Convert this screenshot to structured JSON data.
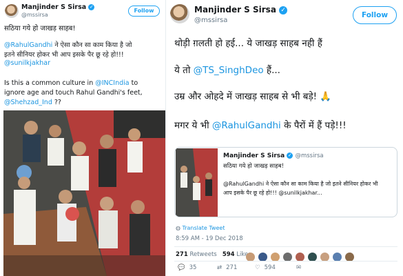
{
  "left": {
    "author": {
      "name": "Manjinder S Sirsa",
      "handle": "@mssirsa"
    },
    "follow_label": "Follow",
    "lines": {
      "l1": "सठिया गये हो जाखड़ साहब!",
      "l2_mention": "@RahulGandhi",
      "l2_rest": " ने ऐसा कौन सा काम किया है जो",
      "l3": "इतने सीनियर होकर भी आप इसके पैर छू रहे हो!!!",
      "l4_mention": "@sunilkjakhar",
      "l5_pre": "Is this a common culture in ",
      "l5_mention": "@INCIndia",
      "l5_post": " to",
      "l6": "ignore age and touch Rahul Gandhi's feet,",
      "l7_mention": "@Shehzad_Ind",
      "l7_post": " ??"
    }
  },
  "right": {
    "author": {
      "name": "Manjinder S Sirsa",
      "handle": "@mssirsa"
    },
    "follow_label": "Follow",
    "lines": {
      "l1": "थोड़ी ग़लती हो हई... ये जाखड़ साहब नही हैं",
      "l2_pre": "ये तो ",
      "l2_mention": "@TS_SinghDeo",
      "l2_post": " हैं...",
      "l3": "उम्र और ओहदे में जाखड़ साहब से भी बड़े! 🙏",
      "l4_pre": "मगर ये भी ",
      "l4_mention": "@RahulGandhi",
      "l4_post": " के पैरों में हैं पड़े!!!"
    },
    "quote": {
      "name": "Manjinder S Sirsa",
      "handle": "@mssirsa",
      "l1": "सठिया गये हो जाखड़ साहब!",
      "l2": "@RahulGandhi ने ऐसा कौन सा काम किया है जो इतने सीनियर होकर भी",
      "l3_pre": "आप इसके पैर छू रहे हो!!! ",
      "l3_mention": "@sunilkjakhar",
      "l3_post": "..."
    },
    "translate": "Translate Tweet",
    "timestamp": "8:59 AM - 19 Dec 2018",
    "retweets_count": "271",
    "retweets_label": "Retweets",
    "likes_count": "594",
    "likes_label": "Likes",
    "actions": {
      "replies": "35",
      "retweets": "271",
      "likes": "594"
    }
  },
  "colors": {
    "accent": "#1da1f2",
    "mention": "#1b95e0",
    "muted": "#657786",
    "retweet": "#17bf63",
    "like": "#e0245e"
  },
  "icons": [
    "verified-icon",
    "chevron-down-icon",
    "globe-icon",
    "reply-icon",
    "retweet-icon",
    "heart-icon",
    "mail-icon"
  ]
}
